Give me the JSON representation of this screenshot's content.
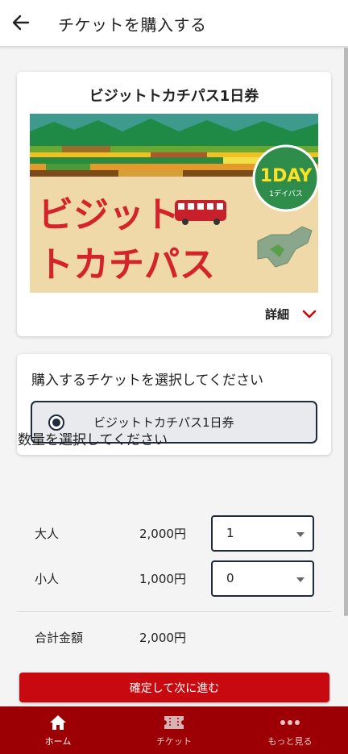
{
  "header": {
    "title": "チケットを購入する",
    "back_icon": "arrow-left-icon"
  },
  "ticket_card": {
    "title": "ビジットトカチパス1日券",
    "banner": {
      "line1": "ビジット",
      "line2": "トカチパス",
      "badge_main": "1DAY",
      "badge_sub": "1デイパス"
    },
    "details_label": "詳細",
    "details_icon": "chevron-down-icon"
  },
  "ticket_select": {
    "heading": "購入するチケットを選択してください",
    "options": [
      {
        "label": "ビジットトカチパス1日券",
        "selected": true
      }
    ]
  },
  "quantity": {
    "heading": "数量を選択してください",
    "rows": [
      {
        "name": "大人",
        "price": "2,000円",
        "value": "1"
      },
      {
        "name": "小人",
        "price": "1,000円",
        "value": "0"
      }
    ],
    "total_label": "合計金額",
    "total_value": "2,000円"
  },
  "confirm_label": "確定して次に進む",
  "bottom_nav": {
    "items": [
      {
        "label": "ホーム",
        "icon": "home-icon",
        "active": true
      },
      {
        "label": "チケット",
        "icon": "ticket-icon",
        "active": false
      },
      {
        "label": "もっと見る",
        "icon": "more-dots-icon",
        "active": false
      }
    ]
  },
  "colors": {
    "brand_red": "#c8090f",
    "nav_red": "#9c0004",
    "navy": "#1f2a3d"
  }
}
